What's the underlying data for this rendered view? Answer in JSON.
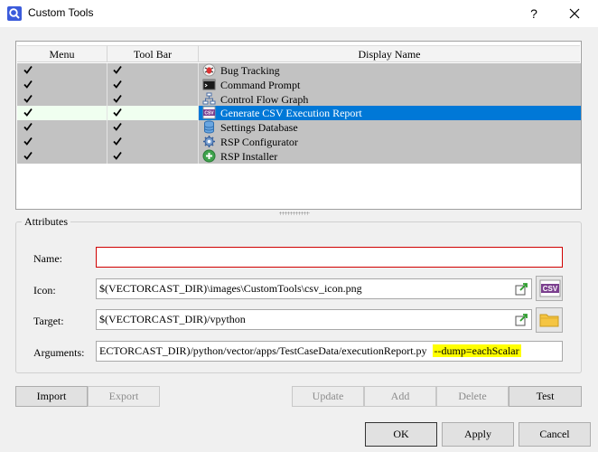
{
  "window": {
    "title": "Custom Tools",
    "help_label": "?",
    "close_icon": "close-icon",
    "app_icon": "search-magnifier-icon"
  },
  "columns": {
    "menu": "Menu",
    "toolbar": "Tool Bar",
    "display_name": "Display Name"
  },
  "tools": [
    {
      "name": "Bug Tracking",
      "menu_checked": true,
      "toolbar_checked": true,
      "icon": "bug-icon",
      "selected": false
    },
    {
      "name": "Command Prompt",
      "menu_checked": true,
      "toolbar_checked": true,
      "icon": "terminal-icon",
      "selected": false
    },
    {
      "name": "Control Flow Graph",
      "menu_checked": true,
      "toolbar_checked": true,
      "icon": "flow-graph-icon",
      "selected": false
    },
    {
      "name": "Generate CSV Execution Report",
      "menu_checked": true,
      "toolbar_checked": true,
      "icon": "csv-icon",
      "selected": true
    },
    {
      "name": "Settings Database",
      "menu_checked": true,
      "toolbar_checked": true,
      "icon": "database-icon",
      "selected": false
    },
    {
      "name": "RSP Configurator",
      "menu_checked": true,
      "toolbar_checked": true,
      "icon": "gear-icon",
      "selected": false
    },
    {
      "name": "RSP Installer",
      "menu_checked": true,
      "toolbar_checked": true,
      "icon": "plus-icon",
      "selected": false
    }
  ],
  "attributes": {
    "group_title": "Attributes",
    "name": {
      "label": "Name:",
      "value": ""
    },
    "icon": {
      "label": "Icon:",
      "value": "$(VECTORCAST_DIR)\\images\\CustomTools\\csv_icon.png"
    },
    "target": {
      "label": "Target:",
      "value": "$(VECTORCAST_DIR)/vpython"
    },
    "arguments": {
      "label": "Arguments:",
      "value": "ECTORCAST_DIR)/python/vector/apps/TestCaseData/executionReport.py",
      "highlighted": "--dump=eachScalar"
    }
  },
  "buttons": {
    "import": "Import",
    "export": "Export",
    "update": "Update",
    "add": "Add",
    "delete": "Delete",
    "test": "Test",
    "ok": "OK",
    "apply": "Apply",
    "cancel": "Cancel"
  },
  "colors": {
    "selection": "#0078d7",
    "row_background": "#c2c2c2",
    "name_error_border": "#d00000",
    "argument_highlight": "#ffff00"
  }
}
